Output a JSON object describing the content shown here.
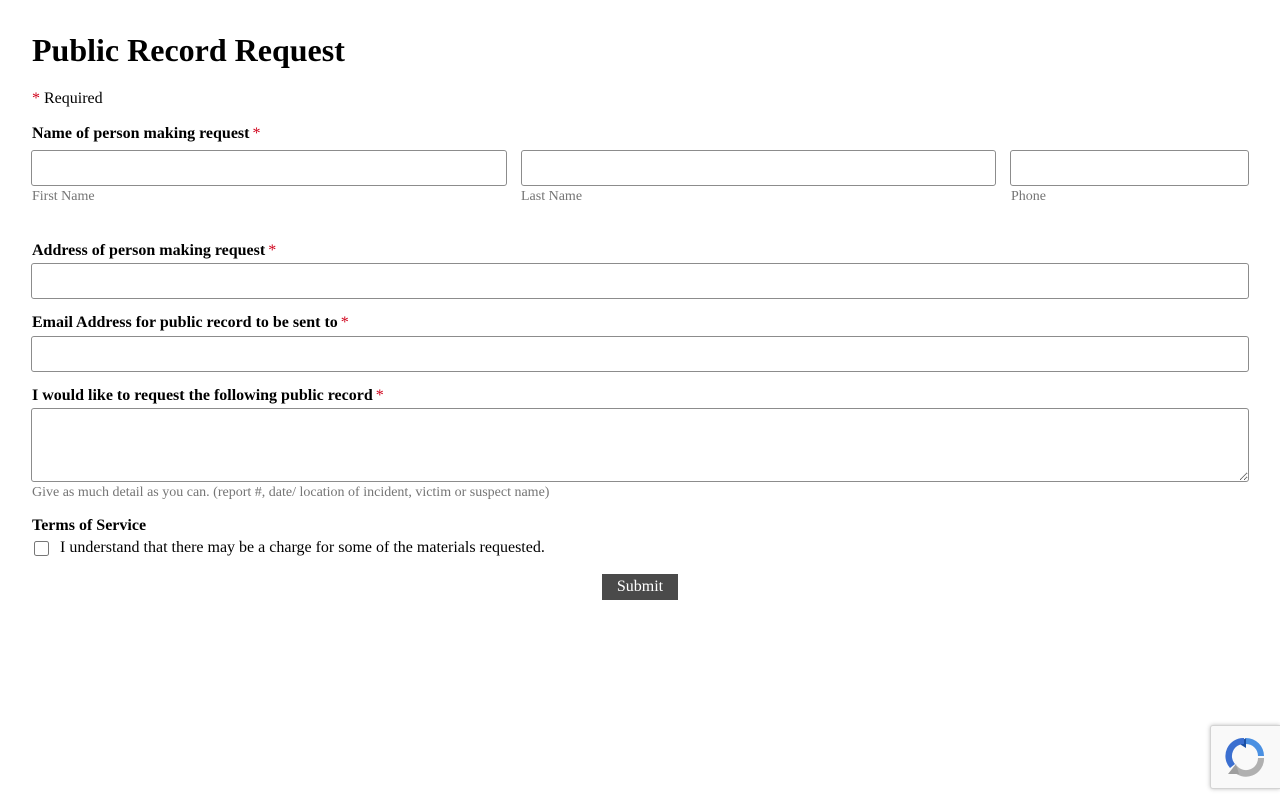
{
  "form": {
    "title": "Public Record Request",
    "required_marker": "*",
    "required_note": "Required",
    "name_field": {
      "label": "Name of person making request",
      "first_name": {
        "value": "",
        "sublabel": "First Name"
      },
      "last_name": {
        "value": "",
        "sublabel": "Last Name"
      },
      "phone": {
        "value": "",
        "sublabel": "Phone"
      }
    },
    "address_field": {
      "label": "Address of person making request",
      "value": ""
    },
    "email_field": {
      "label": "Email Address for public record to be sent to",
      "value": ""
    },
    "record_request_field": {
      "label": "I would like to request the following public record",
      "value": "",
      "help_text": "Give as much detail as you can. (report #, date/ location of incident, victim or suspect name)"
    },
    "terms": {
      "heading": "Terms of Service",
      "checkbox_label": "I understand that there may be a charge for some of the materials requested.",
      "checked": false
    },
    "submit_label": "Submit"
  },
  "recaptcha": {
    "icon": "recaptcha-icon"
  },
  "colors": {
    "required_asterisk": "#d0021b",
    "submit_background": "#4a4a4a",
    "sublabel_text": "#757575",
    "input_border": "#8c8c8c"
  }
}
